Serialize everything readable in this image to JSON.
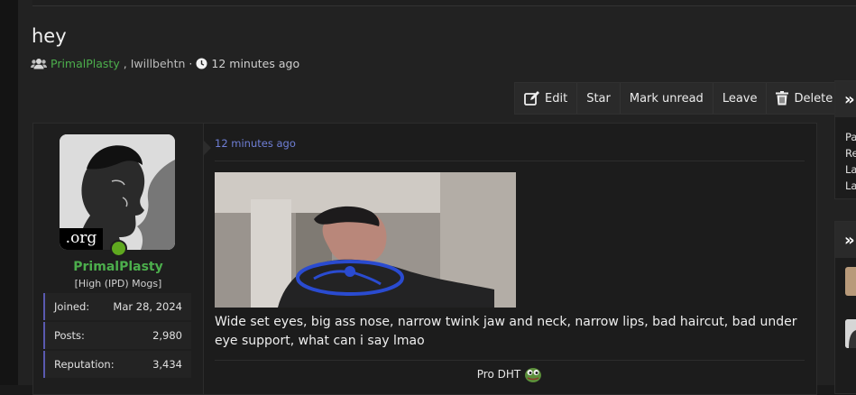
{
  "thread": {
    "title": "hey",
    "participants": [
      "PrimalPlasty",
      "Iwillbehtn"
    ],
    "separator": ",",
    "dot": "·",
    "time": "12 minutes ago"
  },
  "toolbar": {
    "edit": "Edit",
    "star": "Star",
    "mark_unread": "Mark unread",
    "leave": "Leave",
    "delete": "Delete"
  },
  "post": {
    "avatar_label": ".org",
    "username": "PrimalPlasty",
    "user_title": "[High (IPD) Mogs]",
    "stats": [
      {
        "label": "Joined:",
        "value": "Mar 28, 2024"
      },
      {
        "label": "Posts:",
        "value": "2,980"
      },
      {
        "label": "Reputation:",
        "value": "3,434"
      }
    ],
    "time": "12 minutes ago",
    "body": "Wide set eyes, big ass nose, narrow twink jaw and neck, narrow lips, bad haircut, bad under eye support, what can i say lmao",
    "signature": "Pro DHT"
  },
  "sidebar": {
    "toggle": "»",
    "lines": [
      "Pa",
      "Re",
      "La",
      "La"
    ]
  },
  "colors": {
    "accent_green": "#4cae4c",
    "link_blue": "#6f7fd6",
    "stat_border": "#5a5ab0",
    "online": "#5fa81f"
  },
  "icons": [
    "users-icon",
    "clock-icon",
    "edit-icon",
    "trash-icon",
    "pepe-emoji-icon"
  ]
}
